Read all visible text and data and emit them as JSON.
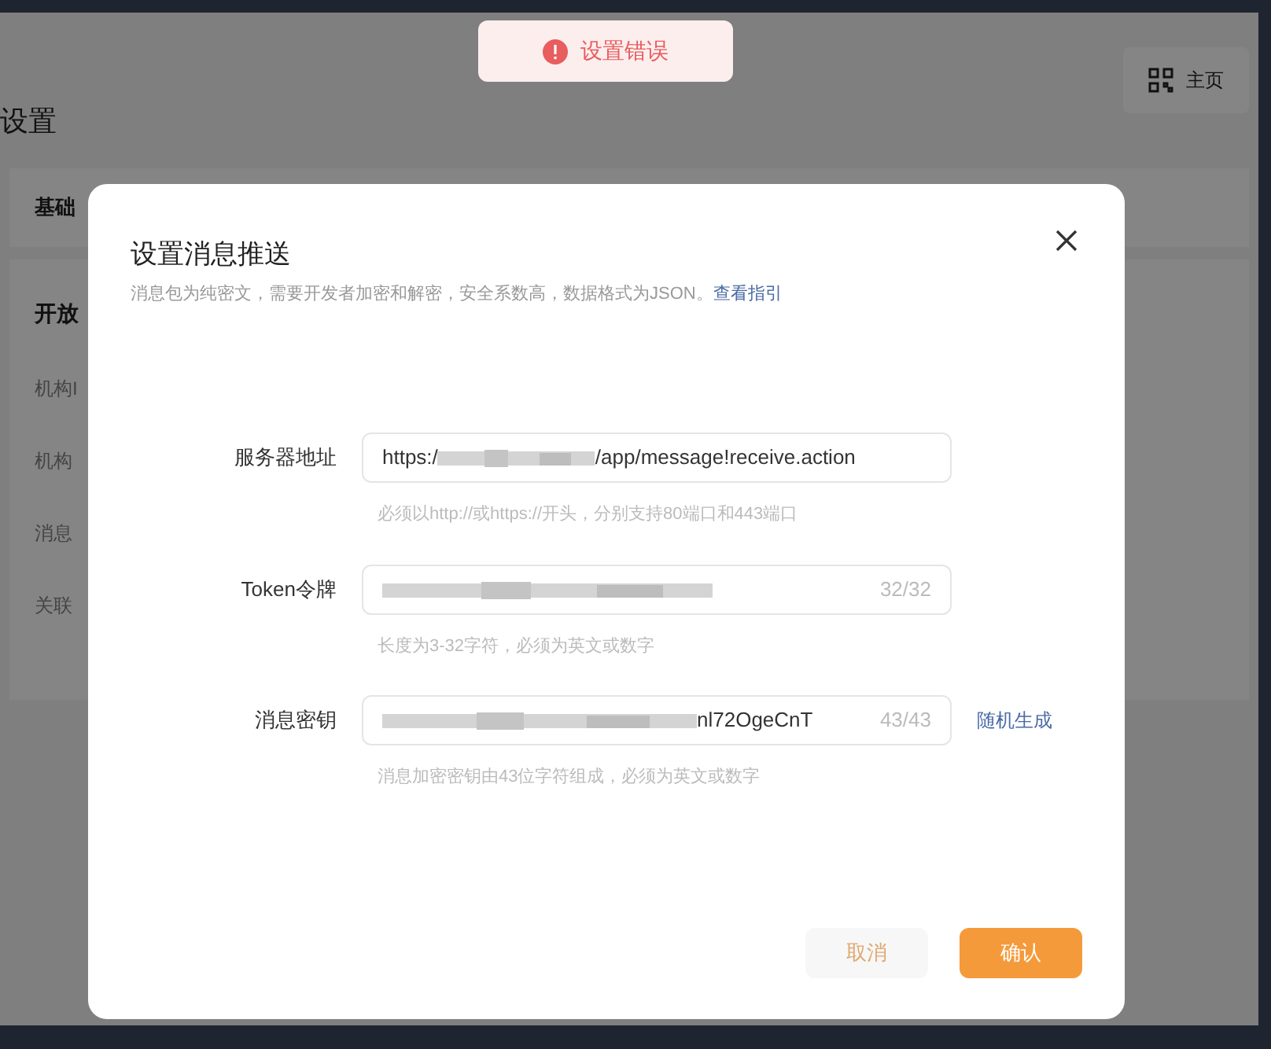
{
  "background_page": {
    "title": "设置",
    "home_button": "主页",
    "section_1": "基础",
    "section_2": "开放",
    "rows": [
      "机构I",
      "机构",
      "消息",
      "关联"
    ]
  },
  "toast": {
    "kind": "error",
    "text": "设置错误"
  },
  "dialog": {
    "title": "设置消息推送",
    "description": "消息包为纯密文，需要开发者加密和解密，安全系数高，数据格式为JSON。",
    "link": "查看指引",
    "fields": [
      {
        "label": "服务器地址",
        "value_start": "https:/",
        "value_end": "/app/message!receive.action",
        "redacted": true,
        "hint": "必须以http://或https://开头，分别支持80端口和443端口"
      },
      {
        "label": "Token令牌",
        "redacted": true,
        "counter": "32/32",
        "hint": "长度为3-32字符，必须为英文或数字"
      },
      {
        "label": "消息密钥",
        "value_end": "nl72OgeCnT",
        "redacted": true,
        "counter": "43/43",
        "action": "随机生成",
        "hint": "消息加密密钥由43位字符组成，必须为英文或数字"
      }
    ],
    "buttons": [
      {
        "label": "取消",
        "kind": "secondary"
      },
      {
        "label": "确认",
        "kind": "primary"
      }
    ]
  }
}
